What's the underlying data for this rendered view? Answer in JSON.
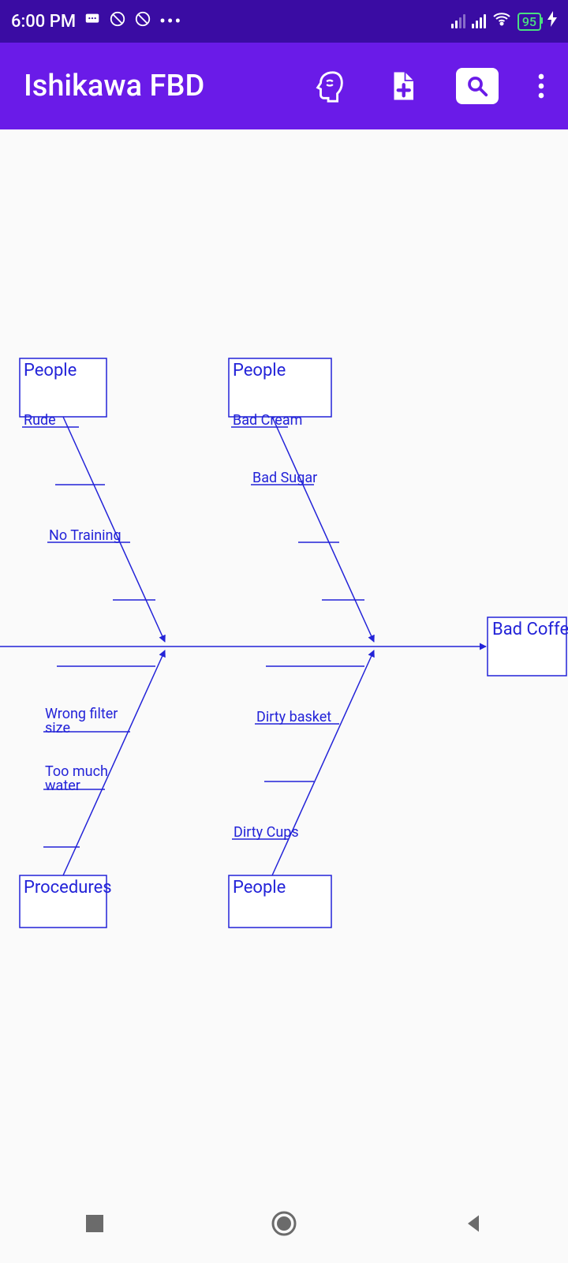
{
  "status": {
    "time": "6:00 PM",
    "battery": "95"
  },
  "appbar": {
    "title": "Ishikawa FBD"
  },
  "diagram": {
    "effect": "Bad Coffee",
    "categories": {
      "top_left": {
        "label": "People",
        "causes": [
          "Rude",
          "",
          "No Training",
          ""
        ]
      },
      "top_right": {
        "label": "People",
        "causes": [
          "Bad Cream",
          "Bad Sugar",
          "",
          ""
        ]
      },
      "bottom_left": {
        "label": "Procedures",
        "causes": [
          "",
          "Wrong filter size",
          "Too much water",
          ""
        ]
      },
      "bottom_right": {
        "label": "People",
        "causes": [
          "",
          "Dirty basket",
          "",
          "Dirty Cups"
        ]
      }
    }
  }
}
